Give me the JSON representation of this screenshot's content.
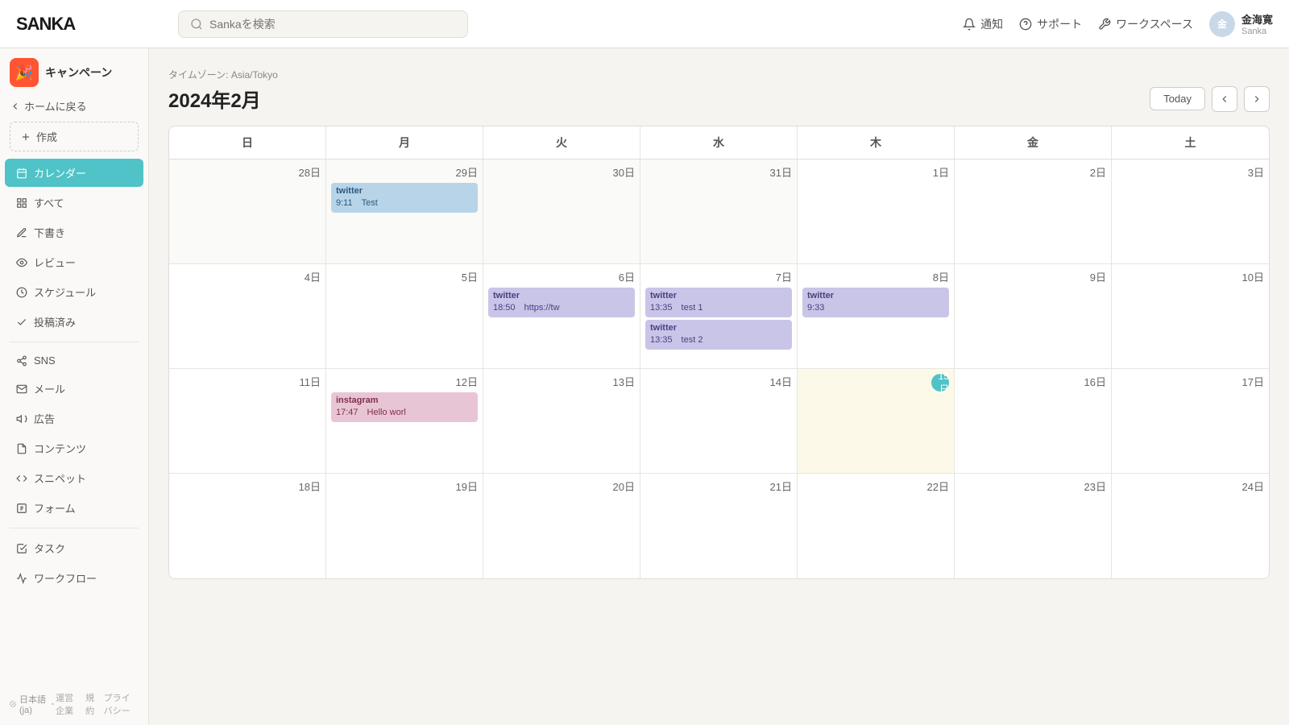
{
  "header": {
    "logo": "SANKA",
    "search_placeholder": "Sankaを検索",
    "notification_label": "通知",
    "support_label": "サポート",
    "workspace_label": "ワークスペース",
    "user_name": "金海寛",
    "user_sub": "Sanka"
  },
  "sidebar": {
    "campaign_icon": "🎉",
    "section_label": "キャンペーン",
    "back_label": "ホームに戻る",
    "create_label": "作成",
    "items": [
      {
        "id": "calendar",
        "label": "カレンダー",
        "active": true
      },
      {
        "id": "all",
        "label": "すべて",
        "active": false
      },
      {
        "id": "draft",
        "label": "下書き",
        "active": false
      },
      {
        "id": "review",
        "label": "レビュー",
        "active": false
      },
      {
        "id": "schedule",
        "label": "スケジュール",
        "active": false
      },
      {
        "id": "posted",
        "label": "投稿済み",
        "active": false
      }
    ],
    "section2_items": [
      {
        "id": "sns",
        "label": "SNS"
      },
      {
        "id": "mail",
        "label": "メール"
      },
      {
        "id": "ads",
        "label": "広告"
      },
      {
        "id": "content",
        "label": "コンテンツ"
      },
      {
        "id": "snippet",
        "label": "スニペット"
      },
      {
        "id": "form",
        "label": "フォーム"
      }
    ],
    "section3_items": [
      {
        "id": "task",
        "label": "タスク"
      },
      {
        "id": "workflow",
        "label": "ワークフロー"
      }
    ],
    "footer": {
      "lang": "日本語 (ja)",
      "links": [
        "運営企業",
        "規約",
        "プライバシー"
      ]
    }
  },
  "calendar": {
    "timezone": "タイムゾーン: Asia/Tokyo",
    "month": "2024年2月",
    "today_btn": "Today",
    "day_headers": [
      "日",
      "月",
      "火",
      "水",
      "木",
      "金",
      "土"
    ],
    "weeks": [
      [
        {
          "date": "28",
          "other": true,
          "events": []
        },
        {
          "date": "29",
          "other": true,
          "events": [
            {
              "platform": "twitter",
              "time": "9:11",
              "title": "Test",
              "type": "blue-gray"
            }
          ]
        },
        {
          "date": "30",
          "other": true,
          "events": []
        },
        {
          "date": "31",
          "other": true,
          "events": []
        },
        {
          "date": "1",
          "events": []
        },
        {
          "date": "2",
          "events": []
        },
        {
          "date": "3",
          "events": []
        }
      ],
      [
        {
          "date": "4",
          "events": []
        },
        {
          "date": "5",
          "events": []
        },
        {
          "date": "6",
          "events": [
            {
              "platform": "twitter",
              "time": "18:50",
              "title": "https://tw",
              "type": "purple"
            }
          ]
        },
        {
          "date": "7",
          "events": [
            {
              "platform": "twitter",
              "time": "13:35",
              "title": "test 1",
              "type": "purple"
            },
            {
              "platform": "twitter",
              "time": "13:35",
              "title": "test 2",
              "type": "purple"
            }
          ]
        },
        {
          "date": "8",
          "events": [
            {
              "platform": "twitter",
              "time": "9:33",
              "title": "",
              "type": "purple"
            }
          ]
        },
        {
          "date": "9",
          "events": []
        },
        {
          "date": "10",
          "events": []
        }
      ],
      [
        {
          "date": "11",
          "events": []
        },
        {
          "date": "12",
          "events": [
            {
              "platform": "instagram",
              "time": "17:47",
              "title": "Hello worl",
              "type": "pink"
            }
          ]
        },
        {
          "date": "13",
          "events": []
        },
        {
          "date": "14",
          "events": []
        },
        {
          "date": "15",
          "today": true,
          "events": []
        },
        {
          "date": "16",
          "events": []
        },
        {
          "date": "17",
          "events": []
        }
      ],
      [
        {
          "date": "18",
          "events": []
        },
        {
          "date": "19",
          "events": []
        },
        {
          "date": "20",
          "events": []
        },
        {
          "date": "21",
          "events": []
        },
        {
          "date": "22",
          "events": []
        },
        {
          "date": "23",
          "events": []
        },
        {
          "date": "24",
          "events": []
        }
      ]
    ]
  }
}
